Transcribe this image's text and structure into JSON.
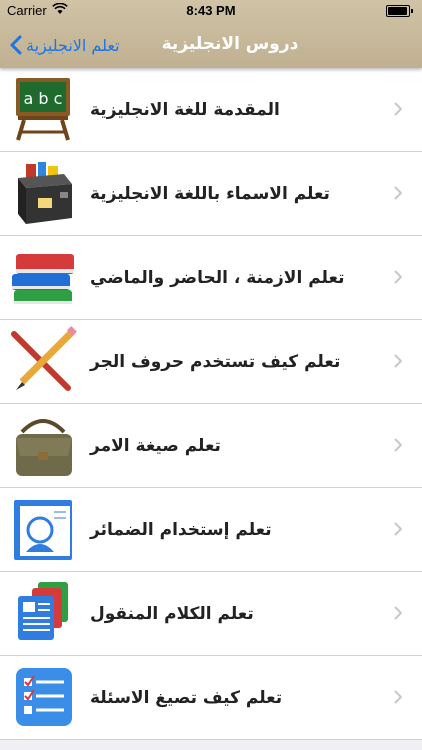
{
  "status_bar": {
    "carrier": "Carrier",
    "time": "8:43 PM",
    "battery_level": 0.95
  },
  "nav": {
    "back_label": "تعلم الانجليزية",
    "title": "دروس الانجليزية"
  },
  "colors": {
    "nav_background": "#c6b797",
    "accent": "#1b74e8"
  },
  "lessons": [
    {
      "label": "المقدمة للغة الانجليزية",
      "icon": "chalkboard-abc-icon"
    },
    {
      "label": "تعلم الاسماء باللغة الانجليزية",
      "icon": "toolbox-icon"
    },
    {
      "label": "تعلم الازمنة ، الحاضر والماضي",
      "icon": "books-stack-icon"
    },
    {
      "label": "تعلم كيف تستخدم حروف الجر",
      "icon": "pencil-ruler-icon"
    },
    {
      "label": "تعلم صيغة الامر",
      "icon": "satchel-icon"
    },
    {
      "label": "تعلم إستخدام الضمائر",
      "icon": "contact-card-icon"
    },
    {
      "label": "تعلم الكلام المنقول",
      "icon": "documents-icon"
    },
    {
      "label": "تعلم كيف تصيغ الاسئلة",
      "icon": "checklist-icon"
    }
  ]
}
